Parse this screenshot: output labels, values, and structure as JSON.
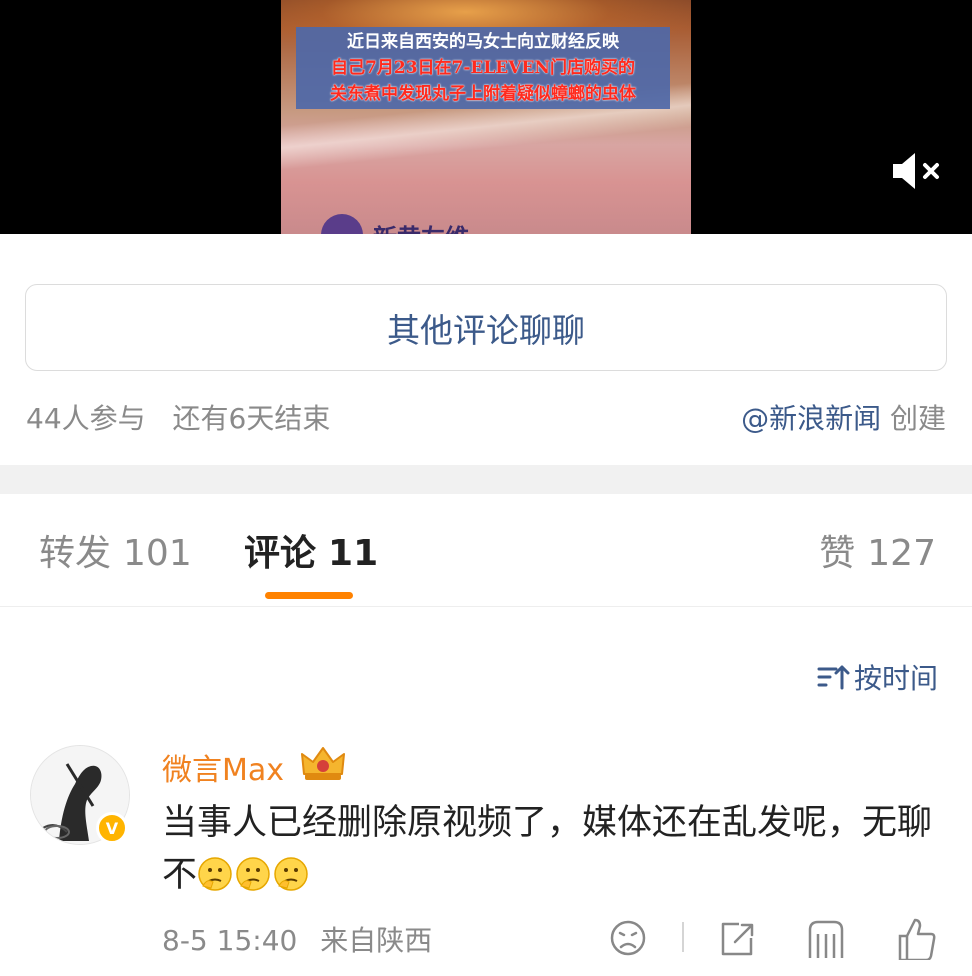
{
  "video": {
    "caption_lines": [
      "近日来自西安的马女士向立财经反映",
      "自己7月23日在7-ELEVEN门店购买的",
      "关东煮中发现丸子上附着疑似蟑螂的虫体"
    ],
    "brand_text": "新黄左维"
  },
  "vote": {
    "other_comments_label": "其他评论聊聊",
    "participants": "44人参与",
    "remaining": "还有6天结束",
    "creator_link": "@新浪新闻",
    "creator_suffix": "创建"
  },
  "tabs": {
    "forward_label": "转发",
    "forward_count": "101",
    "comment_label": "评论",
    "comment_count": "11",
    "like_label": "赞",
    "like_count": "127",
    "accent_color": "#ff8200"
  },
  "sort": {
    "label": "按时间"
  },
  "comment": {
    "username": "微言Max",
    "text": "当事人已经删除原视频了，媒体还在乱发呢，无聊不",
    "emoji_count": 3,
    "time": "8-5 15:40",
    "location": "来自陕西"
  }
}
